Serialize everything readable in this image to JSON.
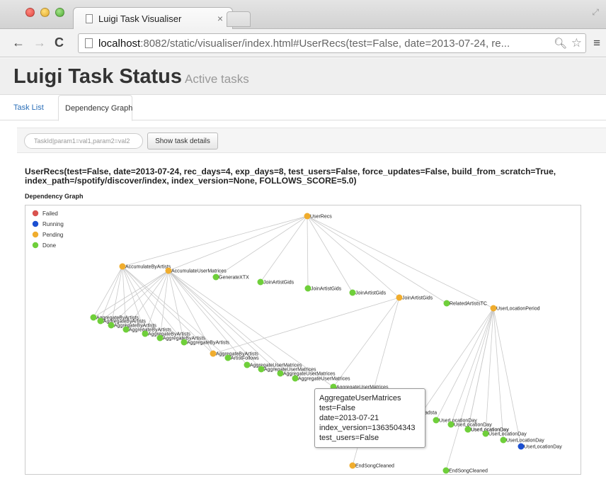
{
  "browser": {
    "tab_title": "Luigi Task Visualiser",
    "tab_close": "×",
    "url_host": "localhost",
    "url_rest": ":8082/static/visualiser/index.html#UserRecs(test=False, date=2013-07-24, re...",
    "icons": [
      "back-arrow-icon",
      "forward-arrow-icon",
      "reload-icon",
      "page-icon",
      "zoom-icon",
      "star-icon",
      "menu-icon"
    ]
  },
  "header": {
    "title": "Luigi Task Status",
    "subtitle": "Active tasks"
  },
  "nav": {
    "tabs": [
      {
        "label": "Task List",
        "active": false
      },
      {
        "label": "Dependency Graph",
        "active": true
      }
    ]
  },
  "controls": {
    "task_input_placeholder": "TaskId|param1=val1,param2=val2",
    "show_button": "Show task details"
  },
  "task": {
    "heading": "UserRecs(test=False, date=2013-07-24, rec_days=4, exp_days=8, test_users=False, force_updates=False, build_from_scratch=True, index_path=/spotify/discover/index, index_version=None, FOLLOWS_SCORE=5.0)"
  },
  "graph": {
    "label": "Dependency Graph",
    "legend": [
      {
        "label": "Failed",
        "color": "#d9534f"
      },
      {
        "label": "Running",
        "color": "#1b4fd1"
      },
      {
        "label": "Pending",
        "color": "#f0ad2e"
      },
      {
        "label": "Done",
        "color": "#6fcf3a"
      }
    ],
    "nodes": [
      {
        "name": "UserRecs",
        "status": "pending"
      },
      {
        "name": "AccumulateByArtists",
        "status": "pending"
      },
      {
        "name": "AccumulateUserMatrices",
        "status": "pending"
      },
      {
        "name": "GenerateXTX",
        "status": "done"
      },
      {
        "name": "JoinArtistGids",
        "status": "done"
      },
      {
        "name": "JoinArtistGids",
        "status": "done"
      },
      {
        "name": "JoinArtistGids",
        "status": "done"
      },
      {
        "name": "JoinArtistGids",
        "status": "pending"
      },
      {
        "name": "RelatedArtistsTC",
        "status": "done"
      },
      {
        "name": "UserLocationPeriod",
        "status": "pending"
      },
      {
        "name": "AggregateByArtists",
        "status": "done"
      },
      {
        "name": "AggregateByArtists",
        "status": "done"
      },
      {
        "name": "AggregateByArtists",
        "status": "done"
      },
      {
        "name": "AggregateByArtists",
        "status": "done"
      },
      {
        "name": "AggregateByArtists",
        "status": "done"
      },
      {
        "name": "AggregateByArtists",
        "status": "done"
      },
      {
        "name": "AggregateByArtists",
        "status": "done"
      },
      {
        "name": "AggregateByArtists",
        "status": "pending"
      },
      {
        "name": "ArtistFollows",
        "status": "done"
      },
      {
        "name": "AggregateUserMatrices",
        "status": "done"
      },
      {
        "name": "AggregateUserMatrices",
        "status": "done"
      },
      {
        "name": "AggregateUserMatrices",
        "status": "done"
      },
      {
        "name": "AggregateUserMatrices",
        "status": "done"
      },
      {
        "name": "AggregateUserMatrices",
        "status": "done"
      },
      {
        "name": "adsta",
        "status": "done"
      },
      {
        "name": "UserLocationDay",
        "status": "done"
      },
      {
        "name": "UserLocationDay",
        "status": "done"
      },
      {
        "name": "UserLocationDay",
        "status": "done"
      },
      {
        "name": "UserLocationDay",
        "status": "done"
      },
      {
        "name": "UserLocationDay",
        "status": "done"
      },
      {
        "name": "UserLocationDay",
        "status": "done"
      },
      {
        "name": "UserLocationDay",
        "status": "running"
      },
      {
        "name": "EndSongCleaned",
        "status": "pending"
      },
      {
        "name": "EndSongCleaned",
        "status": "done"
      }
    ],
    "tooltip": {
      "lines": [
        "AggregateUserMatrices",
        "test=False",
        "date=2013-07-21",
        "index_version=1363504343",
        "test_users=False"
      ]
    }
  }
}
